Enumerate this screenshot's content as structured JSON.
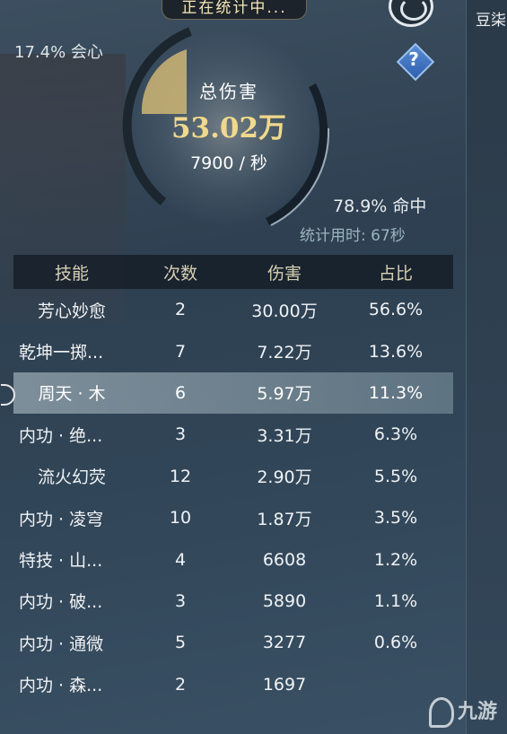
{
  "status": "正在统计中...",
  "right_strip": {
    "label": "豆柒"
  },
  "stats": {
    "crit": "17.4% 会心",
    "total_label": "总伤害",
    "total_value": "53.02万",
    "dps": "7900 / 秒",
    "hit": "78.9% 命中",
    "time": "统计用时: 67秒"
  },
  "table": {
    "headers": [
      "技能",
      "次数",
      "伤害",
      "占比"
    ],
    "rows": [
      {
        "skill": "芳心妙愈",
        "count": "2",
        "damage": "30.00万",
        "percent": "56.6%"
      },
      {
        "skill": "乾坤一掷...",
        "count": "7",
        "damage": "7.22万",
        "percent": "13.6%"
      },
      {
        "skill": "周天 · 木",
        "count": "6",
        "damage": "5.97万",
        "percent": "11.3%"
      },
      {
        "skill": "内功 · 绝...",
        "count": "3",
        "damage": "3.31万",
        "percent": "6.3%"
      },
      {
        "skill": "流火幻荧",
        "count": "12",
        "damage": "2.90万",
        "percent": "5.5%"
      },
      {
        "skill": "内功 · 凌穹",
        "count": "10",
        "damage": "1.87万",
        "percent": "3.5%"
      },
      {
        "skill": "特技 · 山...",
        "count": "4",
        "damage": "6608",
        "percent": "1.2%"
      },
      {
        "skill": "内功 · 破...",
        "count": "3",
        "damage": "5890",
        "percent": "1.1%"
      },
      {
        "skill": "内功 · 通微",
        "count": "5",
        "damage": "3277",
        "percent": "0.6%"
      },
      {
        "skill": "内功 · 森...",
        "count": "2",
        "damage": "1697",
        "percent": ""
      }
    ]
  },
  "watermark": "九游",
  "colors": {
    "accent_gold": "#f0d98c",
    "header_text": "#d6cfb3",
    "highlight_row": "#b4c6ce"
  }
}
